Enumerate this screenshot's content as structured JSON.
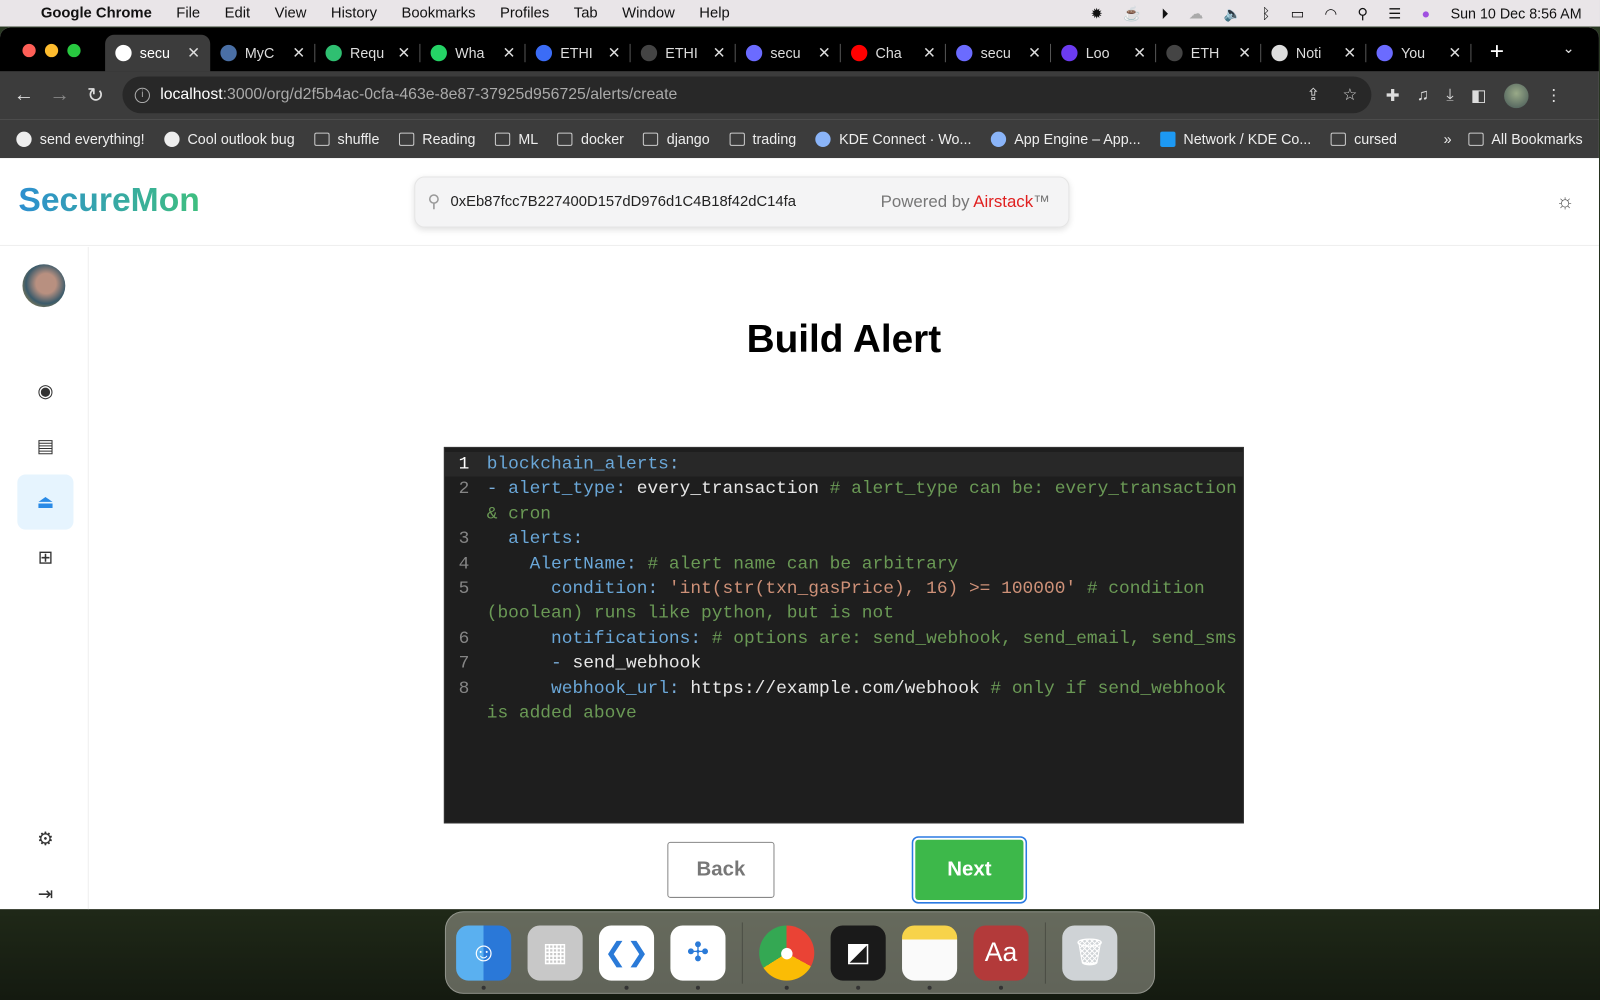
{
  "menubar": {
    "app": "Google Chrome",
    "items": [
      "File",
      "Edit",
      "View",
      "History",
      "Bookmarks",
      "Profiles",
      "Tab",
      "Window",
      "Help"
    ],
    "clock": "Sun 10 Dec  8:56 AM"
  },
  "tabs": [
    {
      "title": "secu",
      "color": "#ffffff",
      "active": true
    },
    {
      "title": "MyC",
      "color": "#4a6fa5"
    },
    {
      "title": "Requ",
      "color": "#2fbf71"
    },
    {
      "title": "Wha",
      "color": "#25d366"
    },
    {
      "title": "ETHI",
      "color": "#3b6cf6"
    },
    {
      "title": "ETHI",
      "color": "#444444"
    },
    {
      "title": "secu",
      "color": "#6b6bff"
    },
    {
      "title": "Cha",
      "color": "#ff0000"
    },
    {
      "title": "secu",
      "color": "#6b6bff"
    },
    {
      "title": "Loo",
      "color": "#6c3bf0"
    },
    {
      "title": "ETH",
      "color": "#444444"
    },
    {
      "title": "Noti",
      "color": "#dddddd"
    },
    {
      "title": "You",
      "color": "#6b6bff"
    }
  ],
  "url": {
    "host": "localhost",
    "path": ":3000/org/d2f5b4ac-0cfa-463e-8e87-37925d956725/alerts/create"
  },
  "bookmarks": [
    {
      "label": "send everything!",
      "icon": "globe"
    },
    {
      "label": "Cool outlook bug",
      "icon": "globe"
    },
    {
      "label": "shuffle",
      "icon": "folder"
    },
    {
      "label": "Reading",
      "icon": "folder"
    },
    {
      "label": "ML",
      "icon": "folder"
    },
    {
      "label": "docker",
      "icon": "folder"
    },
    {
      "label": "django",
      "icon": "folder"
    },
    {
      "label": "trading",
      "icon": "folder"
    },
    {
      "label": "KDE Connect · Wo...",
      "icon": "gear"
    },
    {
      "label": "App Engine – App...",
      "icon": "app-engine"
    },
    {
      "label": "Network / KDE Co...",
      "icon": "kde"
    },
    {
      "label": "cursed",
      "icon": "folder"
    }
  ],
  "bookmarks_more": "»",
  "all_bookmarks": "All Bookmarks",
  "app": {
    "logo": "SecureMon",
    "search_value": "0xEb87fcc7B227400D157dD976d1C4B18f42dC14fa",
    "powered_by": "Powered by ",
    "powered_brand": "Airstack",
    "tm": "™"
  },
  "page": {
    "title": "Build Alert",
    "back": "Back",
    "next": "Next"
  },
  "code": [
    [
      [
        "k",
        "blockchain_alerts"
      ],
      [
        "p",
        ":"
      ]
    ],
    [
      [
        "p",
        "- "
      ],
      [
        "k",
        "alert_type"
      ],
      [
        "p",
        ": "
      ],
      [
        "v",
        "every_transaction"
      ],
      [
        "c",
        " # alert_type can be: every_transaction & cron"
      ]
    ],
    [
      [
        "v",
        "  "
      ],
      [
        "k",
        "alerts"
      ],
      [
        "p",
        ":"
      ]
    ],
    [
      [
        "v",
        "    "
      ],
      [
        "k",
        "AlertName"
      ],
      [
        "p",
        ":"
      ],
      [
        "c",
        " # alert name can be arbitrary"
      ]
    ],
    [
      [
        "v",
        "      "
      ],
      [
        "k",
        "condition"
      ],
      [
        "p",
        ": "
      ],
      [
        "s",
        "'int(str(txn_gasPrice), 16) >= 100000'"
      ],
      [
        "c",
        " # condition (boolean) runs like python, but is not"
      ]
    ],
    [
      [
        "v",
        "      "
      ],
      [
        "k",
        "notifications"
      ],
      [
        "p",
        ":"
      ],
      [
        "c",
        " # options are: send_webhook, send_email, send_sms"
      ]
    ],
    [
      [
        "v",
        "      "
      ],
      [
        "p",
        "- "
      ],
      [
        "v",
        "send_webhook"
      ]
    ],
    [
      [
        "v",
        "      "
      ],
      [
        "k",
        "webhook_url"
      ],
      [
        "p",
        ": "
      ],
      [
        "v",
        "https://example.com/webhook"
      ],
      [
        "c",
        " # only if send_webhook is added above"
      ]
    ]
  ],
  "dock": [
    {
      "name": "finder",
      "bg": "linear-gradient(90deg,#5ab0f0 50%,#2a78d8 50%)",
      "glyph": "☺"
    },
    {
      "name": "launchpad",
      "bg": "#c8c8c8",
      "glyph": "▦"
    },
    {
      "name": "vscode",
      "bg": "#ffffff",
      "glyph": "❮❯"
    },
    {
      "name": "slack",
      "bg": "#ffffff",
      "glyph": "✣"
    },
    {
      "name": "chrome",
      "bg": "conic-gradient(#ea4335 0 33%,#fbbc05 0 66%,#34a853 0)",
      "glyph": "●"
    },
    {
      "name": "linear",
      "bg": "#1a1a1a",
      "glyph": "◩"
    },
    {
      "name": "notes",
      "bg": "linear-gradient(#f7d34a 25%,#fafafa 25%)",
      "glyph": ""
    },
    {
      "name": "dictionary",
      "bg": "#b33a3a",
      "glyph": "Aa"
    },
    {
      "name": "trash",
      "bg": "#cfd3d6",
      "glyph": "🗑"
    }
  ]
}
